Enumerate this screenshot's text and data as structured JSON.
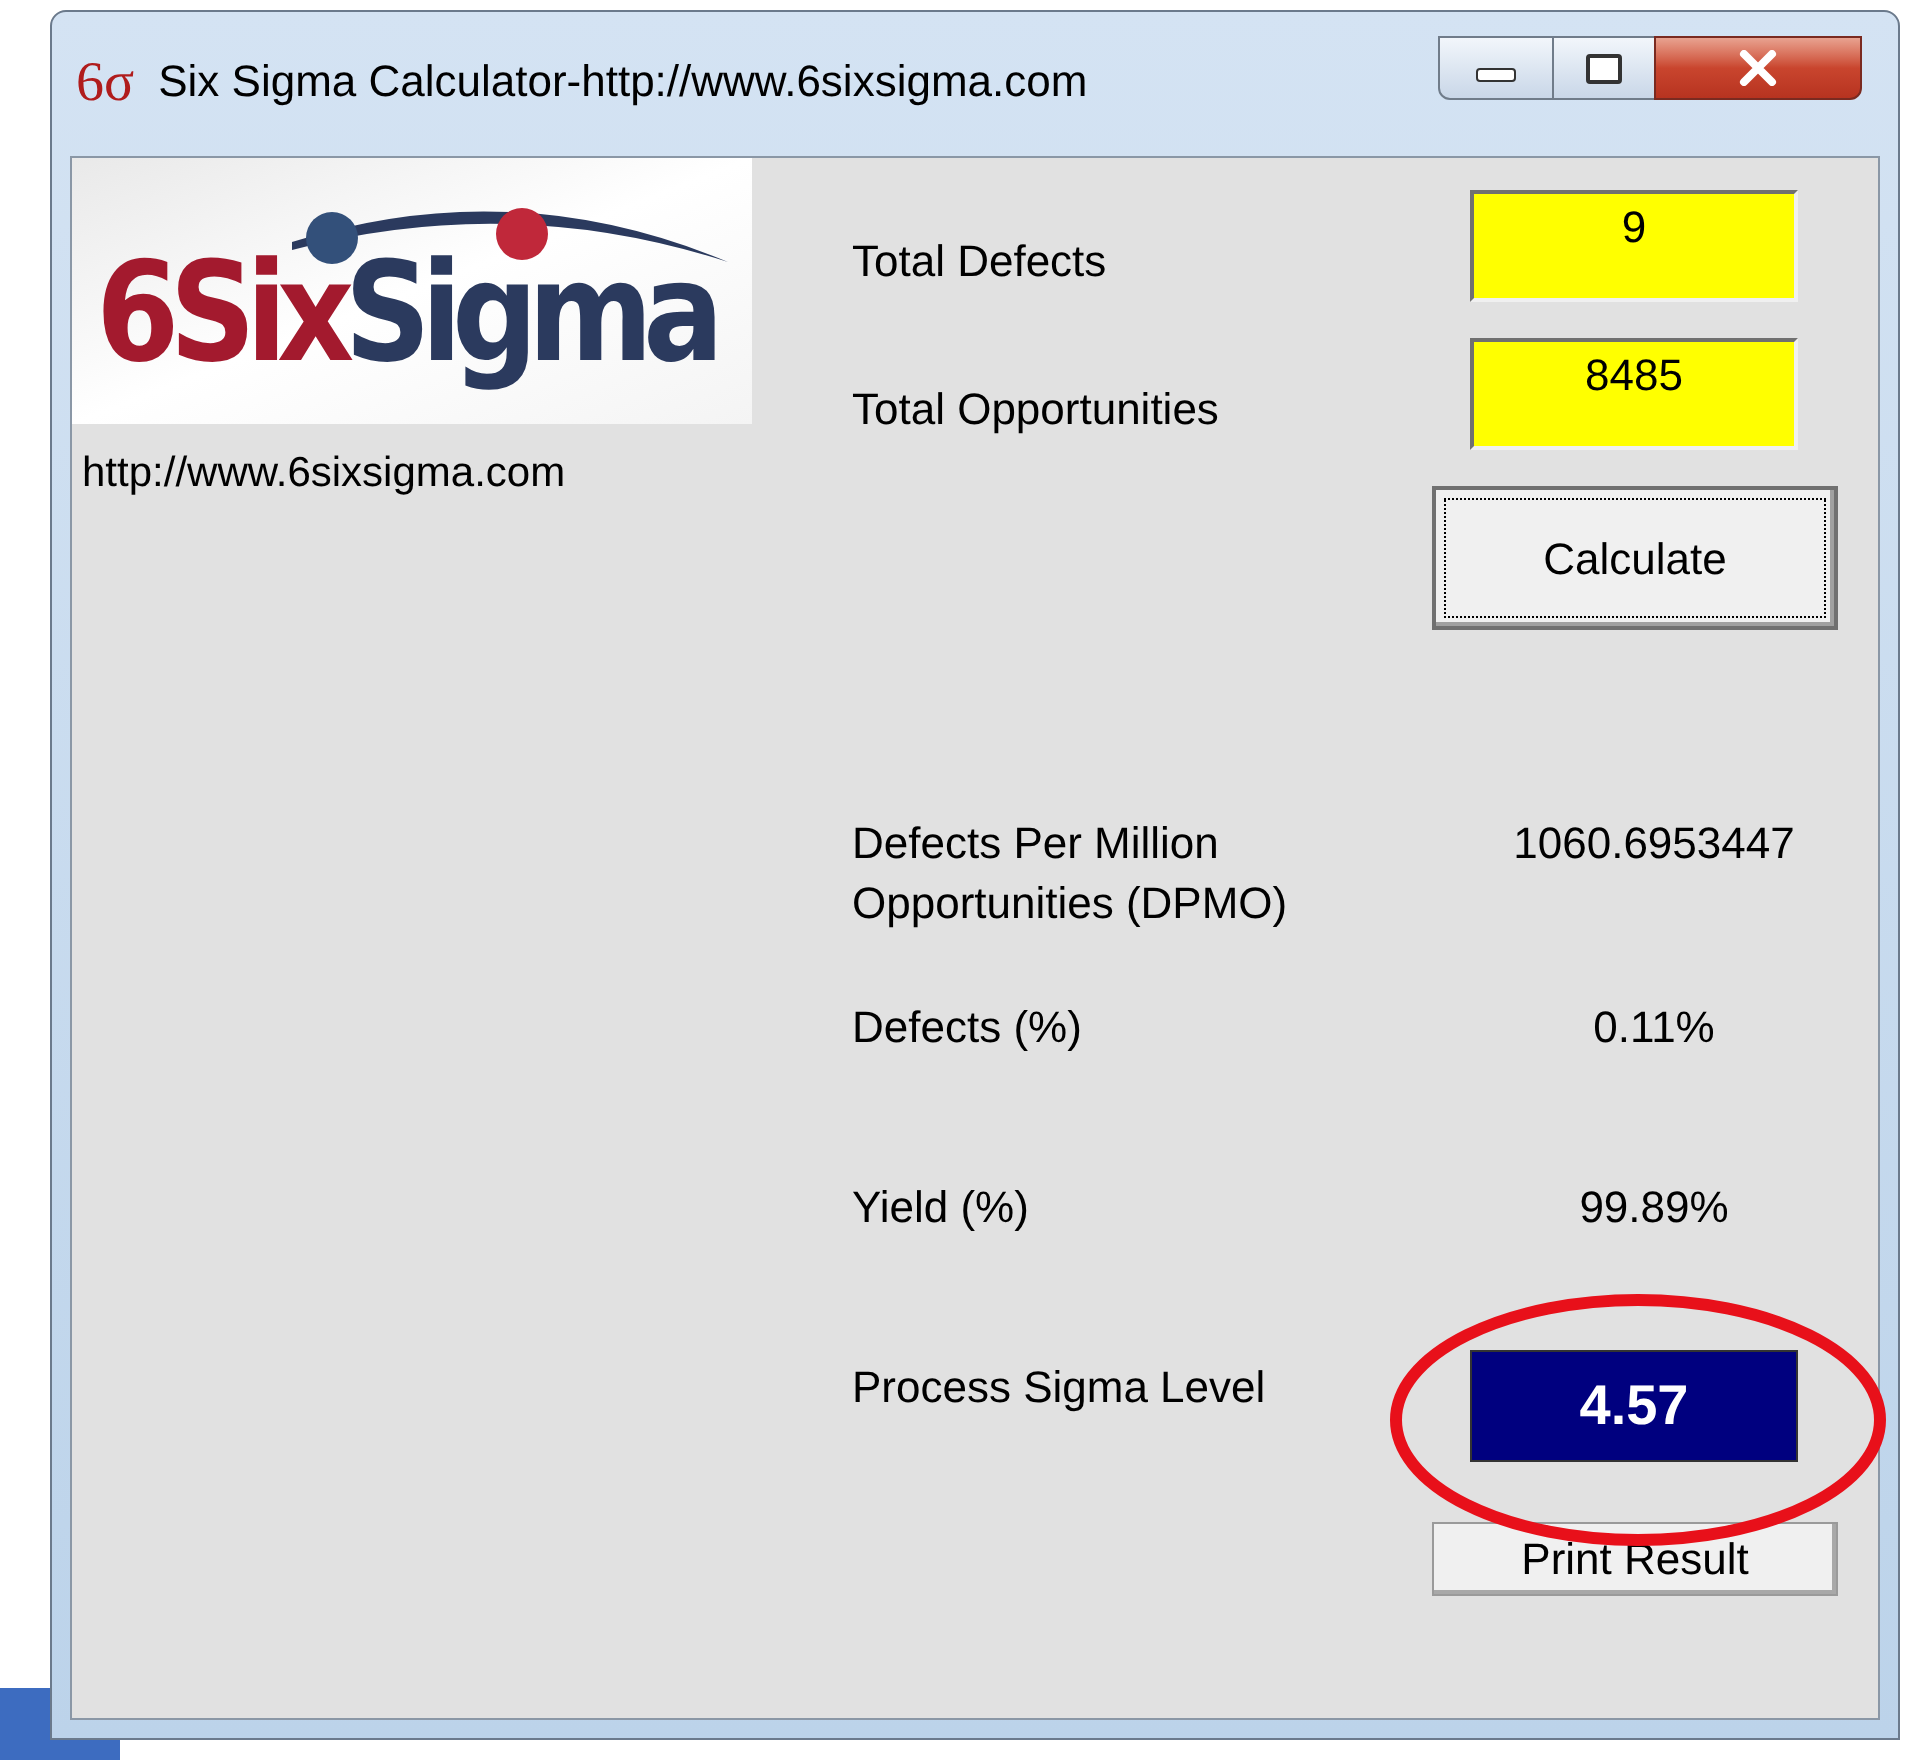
{
  "window": {
    "icon_text": "6σ",
    "title": "Six Sigma Calculator-http://www.6sixsigma.com"
  },
  "logo": {
    "parts": [
      {
        "text": "6Six",
        "color": "#a31a2e"
      },
      {
        "text": "Sigma",
        "color": "#2b3a5e"
      }
    ],
    "url": "http://www.6sixsigma.com"
  },
  "inputs": [
    {
      "label": "Total Defects",
      "value": "9"
    },
    {
      "label": "Total Opportunities",
      "value": "8485"
    }
  ],
  "calculate_button": {
    "label": "Calculate",
    "focused": true
  },
  "results": [
    {
      "kind": "text",
      "label": "Defects Per Million Opportunities (DPMO)",
      "value": "1060.6953447"
    },
    {
      "kind": "text",
      "label": "Defects (%)",
      "value": "0.11%"
    },
    {
      "kind": "text",
      "label": "Yield (%)",
      "value": "99.89%"
    },
    {
      "kind": "box",
      "label": "Process Sigma Level",
      "value": "4.57"
    }
  ],
  "print_button": {
    "label": "Print Result"
  }
}
